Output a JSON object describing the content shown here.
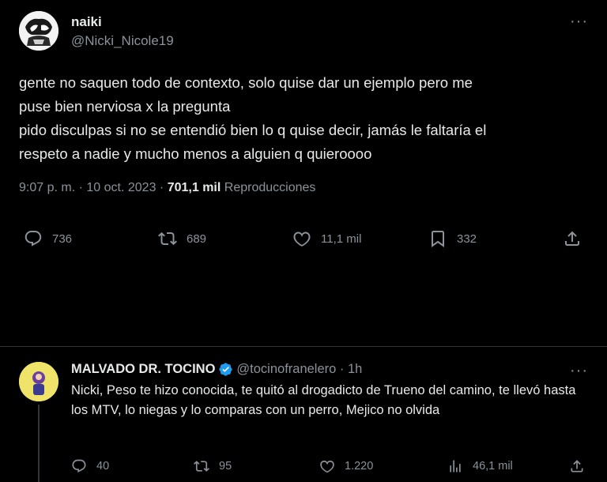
{
  "main_tweet": {
    "display_name": "naiki",
    "handle": "@Nicki_Nicole19",
    "more": "···",
    "text": "gente no saquen todo de contexto, solo quise dar un ejemplo pero me\npuse bien nerviosa x la pregunta\npido disculpas si no se entendió bien lo q quise decir, jamás le faltaría el\nrespeto a nadie y mucho menos a alguien q quieroooo",
    "time": "9:07 p. m.",
    "sep1": "·",
    "date": "10 oct. 2023",
    "sep2": "·",
    "views": "701,1 mil",
    "views_label": "Reproducciones",
    "replies": "736",
    "retweets": "689",
    "likes": "11,1 mil",
    "bookmarks": "332"
  },
  "reply_tweet": {
    "display_name": "MALVADO DR. TOCINO",
    "handle_time": "@tocinofranelero · 1h",
    "more": "···",
    "text": "Nicki, Peso te hizo conocida, te quitó al drogadicto de Trueno del camino, te llevó hasta los MTV, lo niegas y lo comparas con un perro, Mejico no olvida",
    "replies": "40",
    "retweets": "95",
    "likes": "1.220",
    "views": "46,1 mil"
  },
  "colors": {
    "background": "#000000",
    "text": "#e7e9ea",
    "secondary": "#8b9299",
    "divider": "#2f3336",
    "verified": "#1d9bf0"
  }
}
